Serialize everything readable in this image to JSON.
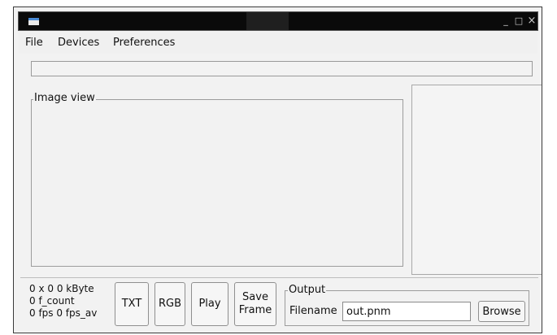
{
  "window": {
    "controls": {
      "minimize": "_",
      "maximize": "□",
      "close": "×"
    }
  },
  "menu": {
    "items": [
      "File",
      "Devices",
      "Preferences"
    ]
  },
  "progress": {
    "value": 0
  },
  "image_view": {
    "title": "Image view"
  },
  "stats": {
    "line1": "0 x 0 0 kByte",
    "line2": "0 f_count",
    "line3": "0 fps  0 fps_av"
  },
  "buttons": {
    "txt": "TXT",
    "rgb": "RGB",
    "play": "Play",
    "save_frame_line1": "Save",
    "save_frame_line2": "Frame"
  },
  "output": {
    "title": "Output",
    "filename_label": "Filename",
    "filename_value": "out.pnm",
    "browse": "Browse"
  }
}
